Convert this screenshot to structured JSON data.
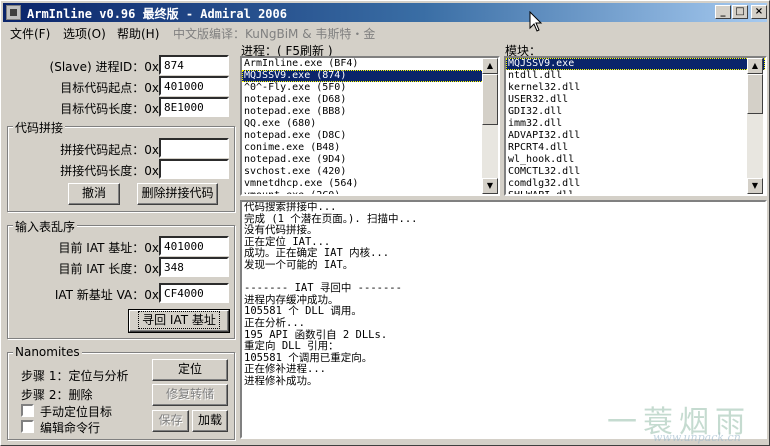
{
  "window": {
    "title": "ArmInline v0.96 最终版 - Admiral 2006",
    "min_glyph": "_",
    "max_glyph": "□",
    "close_glyph": "×"
  },
  "menu": {
    "file": "文件(F)",
    "options": "选项(O)",
    "help": "帮助(H)",
    "credit": "中文版编译：KuNgBiM & 韦斯特・金"
  },
  "left": {
    "slave_pid_label": "(Slave) 进程ID：0x",
    "slave_pid": "874",
    "target_start_label": "目标代码起点：0x",
    "target_start": "401000",
    "target_len_label": "目标代码长度：0x",
    "target_len": "8E1000",
    "splice": {
      "title": "代码拼接",
      "start_label": "拼接代码起点：0x",
      "start": "",
      "len_label": "拼接代码长度：0x",
      "len": "",
      "undo_label": "撤消",
      "remove_label": "删除拼接代码"
    },
    "iat": {
      "title": "输入表乱序",
      "base_label": "目前 IAT 基址：0x",
      "base": "401000",
      "len_label": "目前 IAT 长度：0x",
      "len": "348",
      "new_va_label": "IAT 新基址 VA：0x",
      "new_va": "CF4000",
      "find_label": "寻回 IAT 基址"
    },
    "nanomites": {
      "title": "Nanomites",
      "step1": "步骤 1：定位与分析",
      "step2": "步骤 2：删除",
      "locate_label": "定位",
      "repair_label": "修复转储",
      "manual_label": "手动定位目标",
      "cmdline_label": "编辑命令行",
      "save_label": "保存",
      "load_label": "加载"
    }
  },
  "processes": {
    "header": "进程：( F5刷新 )",
    "selected_index": 1,
    "items": [
      "ArmInline.exe (BF4)",
      "MQJSSV9.exe (874)",
      "^0^-Fly.exe (5F0)",
      "notepad.exe (D68)",
      "notepad.exe (BB8)",
      "QQ.exe (680)",
      "notepad.exe (D8C)",
      "conime.exe (B48)",
      "notepad.exe (9D4)",
      "svchost.exe (420)",
      "vmnetdhcp.exe (564)",
      "vmount.exe (2C0)"
    ]
  },
  "modules": {
    "header": "模块：",
    "selected_index": 0,
    "items": [
      "MQJSSV9.exe",
      "ntdll.dll",
      "kernel32.dll",
      "USER32.dll",
      "GDI32.dll",
      "imm32.dll",
      "ADVAPI32.dll",
      "RPCRT4.dll",
      "wl_hook.dll",
      "COMCTL32.dll",
      "comdlg32.dll",
      "SHLWAPI.dll"
    ]
  },
  "log": {
    "lines": [
      "代码搜索拼接中...",
      "完成 (1 个潜在页面。). 扫描中...",
      "没有代码拼接。",
      "正在定位 IAT...",
      "成功。正在确定 IAT 内核...",
      "发现一个可能的 IAT。",
      "",
      "------- IAT 寻回中 -------",
      "进程内存缓冲成功。",
      "105581 个 DLL 调用。",
      "正在分析...",
      "195 API 函数引自 2 DLLs.",
      "重定向 DLL 引用：",
      "105581 个调用已重定向。",
      "正在修补进程...",
      "进程修补成功。"
    ]
  },
  "watermark": {
    "text": "一蓑烟雨",
    "url": "www.unpack.cn"
  }
}
